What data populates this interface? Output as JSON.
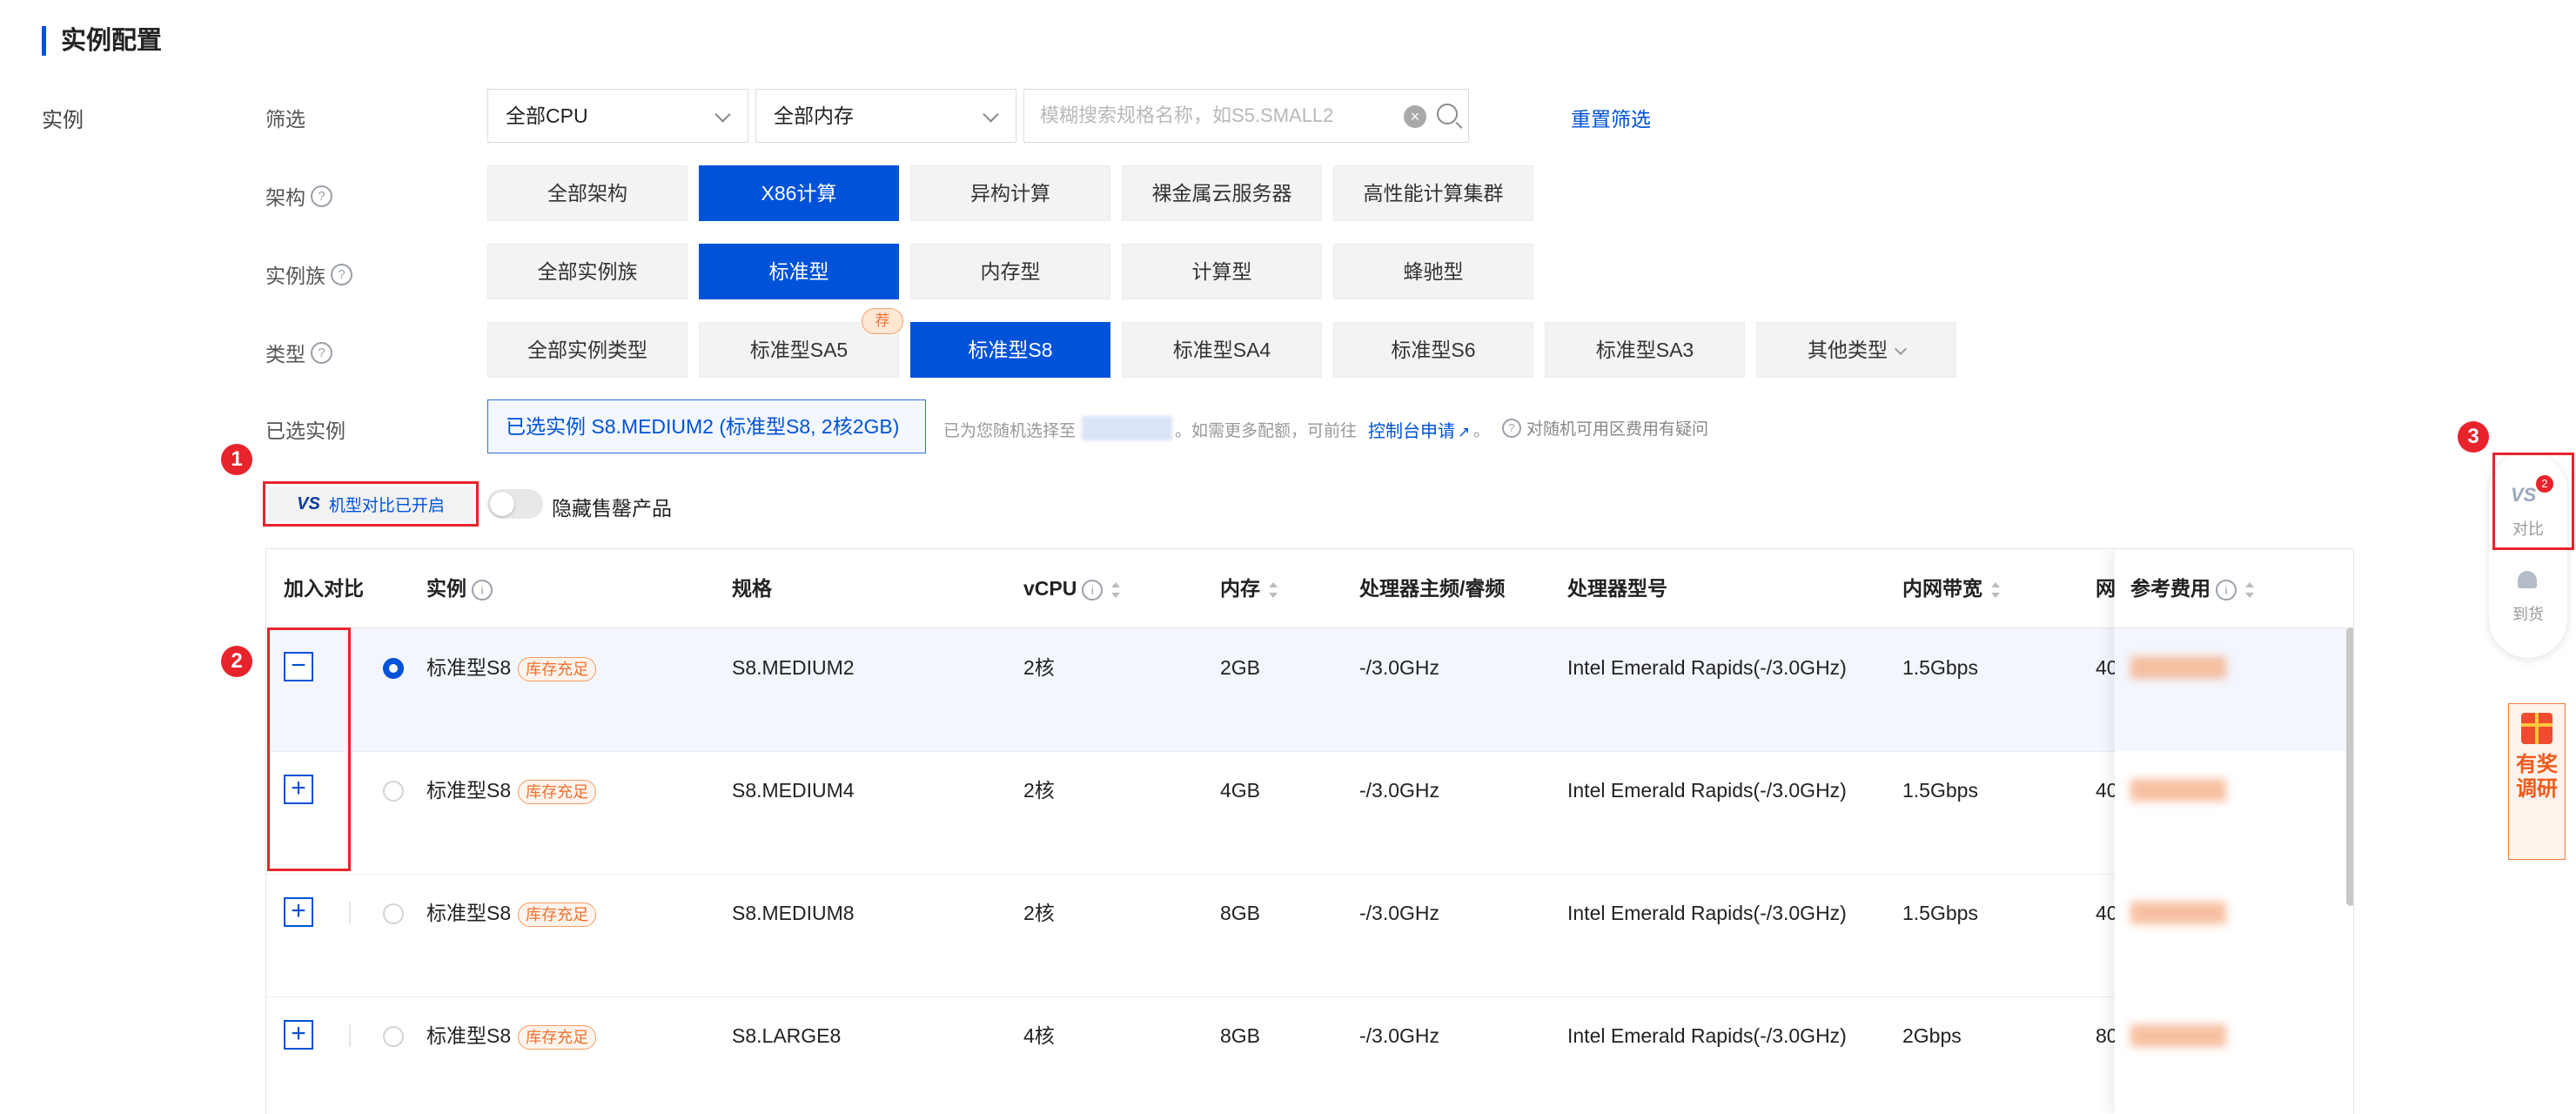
{
  "section_title": "实例配置",
  "left_label": "实例",
  "filter": {
    "label": "筛选",
    "cpu_select": "全部CPU",
    "mem_select": "全部内存",
    "search_placeholder": "模糊搜索规格名称，如S5.SMALL2",
    "reset_link": "重置筛选"
  },
  "arch": {
    "label": "架构",
    "options": [
      "全部架构",
      "X86计算",
      "异构计算",
      "裸金属云服务器",
      "高性能计算集群"
    ],
    "selected": "X86计算"
  },
  "family": {
    "label": "实例族",
    "options": [
      "全部实例族",
      "标准型",
      "内存型",
      "计算型",
      "蜂驰型"
    ],
    "selected": "标准型"
  },
  "type": {
    "label": "类型",
    "options": [
      "全部实例类型",
      "标准型SA5",
      "标准型S8",
      "标准型SA4",
      "标准型S6",
      "标准型SA3",
      "其他类型"
    ],
    "selected": "标准型S8",
    "recommend_badge": "荐"
  },
  "selected_instance": {
    "label": "已选实例",
    "value": "已选实例  S8.MEDIUM2 (标准型S8, 2核2GB)",
    "note_prefix": "已为您随机选择至",
    "note_middle": "。如需更多配额，可前往",
    "console_link": "控制台申请",
    "note_suffix": "。",
    "question_text": "对随机可用区费用有疑问"
  },
  "compare_toggle": {
    "logo": "VS",
    "label": "机型对比已开启"
  },
  "hide_sold_out": {
    "label": "隐藏售罄产品"
  },
  "annotations": [
    "1",
    "2",
    "3"
  ],
  "table": {
    "headers": {
      "compare": "加入对比",
      "instance": "实例",
      "spec": "规格",
      "vcpu": "vCPU",
      "memory": "内存",
      "freq": "处理器主频/睿频",
      "cpu_model": "处理器型号",
      "bandwidth": "内网带宽",
      "net_partial": "网",
      "price": "参考费用"
    },
    "stock_label": "库存充足",
    "rows": [
      {
        "action": "−",
        "selected": true,
        "family": "标准型S8",
        "spec": "S8.MEDIUM2",
        "vcpu": "2核",
        "memory": "2GB",
        "freq": "-/3.0GHz",
        "cpu_model": "Intel Emerald Rapids(-/3.0GHz)",
        "bandwidth": "1.5Gbps",
        "net_partial": "40"
      },
      {
        "action": "+",
        "selected": false,
        "family": "标准型S8",
        "spec": "S8.MEDIUM4",
        "vcpu": "2核",
        "memory": "4GB",
        "freq": "-/3.0GHz",
        "cpu_model": "Intel Emerald Rapids(-/3.0GHz)",
        "bandwidth": "1.5Gbps",
        "net_partial": "40"
      },
      {
        "action": "+",
        "selected": false,
        "family": "标准型S8",
        "spec": "S8.MEDIUM8",
        "vcpu": "2核",
        "memory": "8GB",
        "freq": "-/3.0GHz",
        "cpu_model": "Intel Emerald Rapids(-/3.0GHz)",
        "bandwidth": "1.5Gbps",
        "net_partial": "40"
      },
      {
        "action": "+",
        "selected": false,
        "family": "标准型S8",
        "spec": "S8.LARGE8",
        "vcpu": "4核",
        "memory": "8GB",
        "freq": "-/3.0GHz",
        "cpu_model": "Intel Emerald Rapids(-/3.0GHz)",
        "bandwidth": "2Gbps",
        "net_partial": "80"
      }
    ]
  },
  "side_panel": {
    "compare_label": "对比",
    "compare_count": "2",
    "notify_label": "到货"
  },
  "survey": {
    "text": "有奖调研"
  },
  "colors": {
    "primary": "#0052d9",
    "annotation_red": "#e8232c",
    "stock_orange": "#f07030"
  },
  "icons": [
    "help-icon",
    "chevron-down-icon",
    "clear-icon",
    "search-icon",
    "external-link-icon",
    "sort-icon",
    "info-icon",
    "bell-icon",
    "gift-icon",
    "vs-icon"
  ]
}
